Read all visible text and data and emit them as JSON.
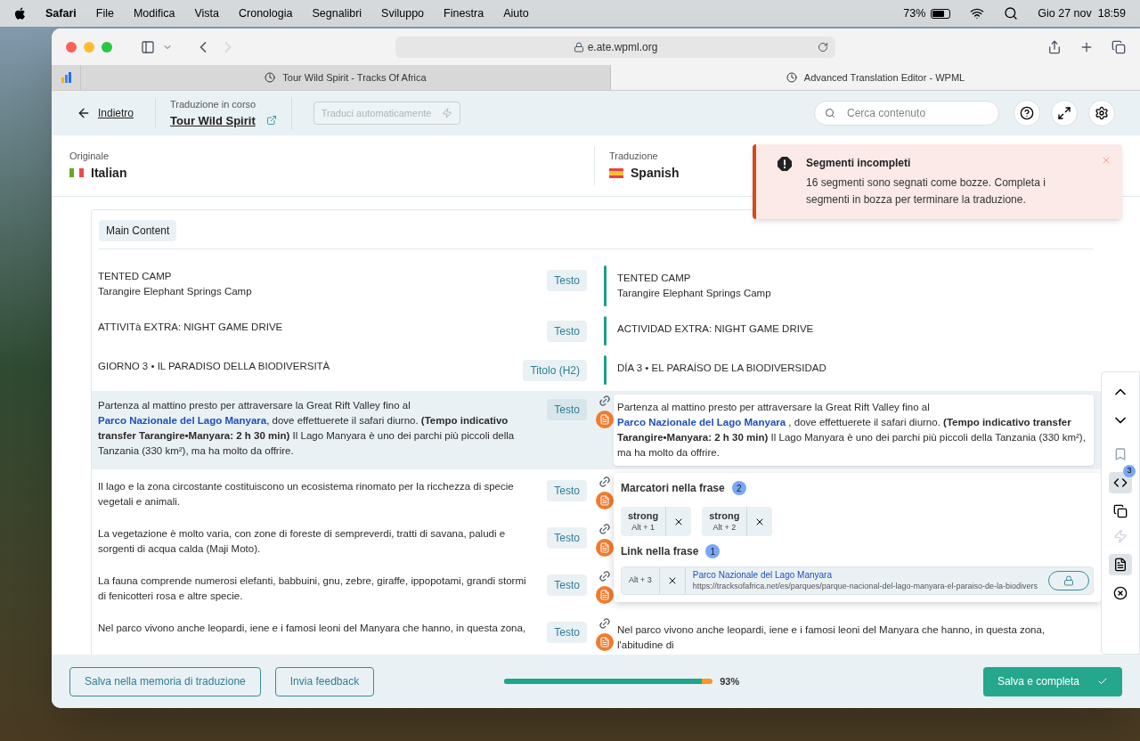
{
  "menubar": {
    "app": "Safari",
    "menus": [
      "File",
      "Modifica",
      "Vista",
      "Cronologia",
      "Segnalibri",
      "Sviluppo",
      "Finestra",
      "Aiuto"
    ],
    "battery": "73%",
    "clock": "Gio 27 nov  18:59"
  },
  "browser": {
    "address": "e.ate.wpml.org",
    "tabs": [
      {
        "title": "Tour Wild Spirit - Tracks Of Africa",
        "selected": false
      },
      {
        "title": "Advanced Translation Editor - WPML",
        "selected": true
      }
    ]
  },
  "toolbar": {
    "back": "Indietro",
    "status_label": "Traduzione in corso",
    "page_title": "Tour Wild Spirit",
    "auto_translate": {
      "label": "Traduci automaticamente",
      "disabled": true
    },
    "search": {
      "placeholder": "Cerca contenuto"
    }
  },
  "languages": {
    "source": {
      "caption": "Originale",
      "name": "Italian"
    },
    "target": {
      "caption": "Traduzione",
      "name": "Spanish"
    }
  },
  "notification": {
    "title": "Segmenti incompleti",
    "message": "16 segmenti sono segnati come bozze. Completa i segmenti in bozza per terminare la traduzione."
  },
  "section": "Main Content",
  "segments": [
    {
      "source": [
        {
          "kind": "text",
          "text": "TENTED CAMP\nTarangire Elephant Springs Camp"
        }
      ],
      "tag": "Testo",
      "draft": false,
      "selected": false,
      "target": [
        {
          "kind": "text",
          "text": "TENTED CAMP\nTarangire Elephant Springs Camp"
        }
      ]
    },
    {
      "source": [
        {
          "kind": "text",
          "text": "ATTIVITà EXTRA: NIGHT GAME DRIVE"
        }
      ],
      "tag": "Testo",
      "draft": false,
      "selected": false,
      "target": [
        {
          "kind": "text",
          "text": "ACTIVIDAD EXTRA: NIGHT GAME DRIVE"
        }
      ]
    },
    {
      "source": [
        {
          "kind": "text",
          "text": "GIORNO 3 • IL PARADISO DELLA BIODIVERSITÀ"
        }
      ],
      "tag": "Titolo (H2)",
      "draft": false,
      "selected": false,
      "target": [
        {
          "kind": "text",
          "text": "DÍA 3 • EL PARAÍSO DE LA BIODIVERSIDAD"
        }
      ]
    },
    {
      "source": [
        {
          "kind": "text",
          "text": "Partenza al mattino presto per attraversare la Great Rift Valley fino al "
        },
        {
          "kind": "link",
          "text": "Parco Nazionale del Lago Manyara"
        },
        {
          "kind": "text",
          "text": ", dove effettuerete il safari diurno. "
        },
        {
          "kind": "bold",
          "text": "(Tempo indicativo transfer Tarangire•Manyara: 2 h 30 min)"
        },
        {
          "kind": "text",
          "text": " Il Lago Manyara è uno dei parchi più piccoli della Tanzania (330 km²), ma ha molto da offrire."
        }
      ],
      "tag": "Testo",
      "draft": true,
      "selected": true,
      "target": [
        {
          "kind": "text",
          "text": "Partenza al mattino presto per attraversare la Great Rift Valley fino al "
        },
        {
          "kind": "link",
          "text": "Parco Nazionale del Lago Manyara"
        },
        {
          "kind": "text",
          "text": " , dove effettuerete il safari diurno. "
        },
        {
          "kind": "bold",
          "text": "(Tempo indicativo transfer Tarangire•Manyara: 2 h 30 min)"
        },
        {
          "kind": "text",
          "text": " Il Lago Manyara è uno dei parchi più piccoli della Tanzania (330 km²), ma ha molto da offrire."
        }
      ]
    },
    {
      "source": [
        {
          "kind": "text",
          "text": "Il lago e la zona circostante costituiscono un ecosistema rinomato per la ricchezza di specie vegetali e animali."
        }
      ],
      "tag": "Testo",
      "draft": true,
      "selected": false
    },
    {
      "source": [
        {
          "kind": "text",
          "text": "La vegetazione è molto varia, con zone di foreste di sempreverdi, tratti di savana, paludi e sorgenti di acqua calda (Maji Moto)."
        }
      ],
      "tag": "Testo",
      "draft": true,
      "selected": false
    },
    {
      "source": [
        {
          "kind": "text",
          "text": "La fauna comprende numerosi elefanti, babbuini, gnu, zebre, giraffe, ippopotami, grandi stormi di fenicotteri rosa e altre specie."
        }
      ],
      "tag": "Testo",
      "draft": true,
      "selected": false
    },
    {
      "source": [
        {
          "kind": "text",
          "text": "Nel parco vivono anche leopardi, iene e i famosi leoni del Manyara che hanno, in questa zona,"
        }
      ],
      "tag": "Testo",
      "draft": true,
      "selected": false,
      "target": [
        {
          "kind": "text",
          "text": "Nel parco vivono anche leopardi, iene e i famosi leoni del Manyara che hanno, in questa zona, l'abitudine di"
        }
      ]
    }
  ],
  "markers_panel": {
    "markers_title": "Marcatori nella frase",
    "markers_count": "2",
    "markers": [
      {
        "name": "strong",
        "shortcut": "Alt + 1"
      },
      {
        "name": "strong",
        "shortcut": "Alt + 2"
      }
    ],
    "links_title": "Link nella frase",
    "links_count": "1",
    "links": [
      {
        "shortcut": "Alt + 3",
        "text": "Parco Nazionale del Lago Manyara",
        "url": "https://tracksofafrica.net/es/parques/parque-nacional-del-lago-manyara-el-paraiso-de-la-biodivers"
      }
    ]
  },
  "side_tools": {
    "tags_badge": "3"
  },
  "footer": {
    "save_memory": "Salva nella memoria di traduzione",
    "feedback": "Invia feedback",
    "progress": {
      "level": 0.95,
      "reading": "93%"
    },
    "complete": "Salva e completa"
  }
}
